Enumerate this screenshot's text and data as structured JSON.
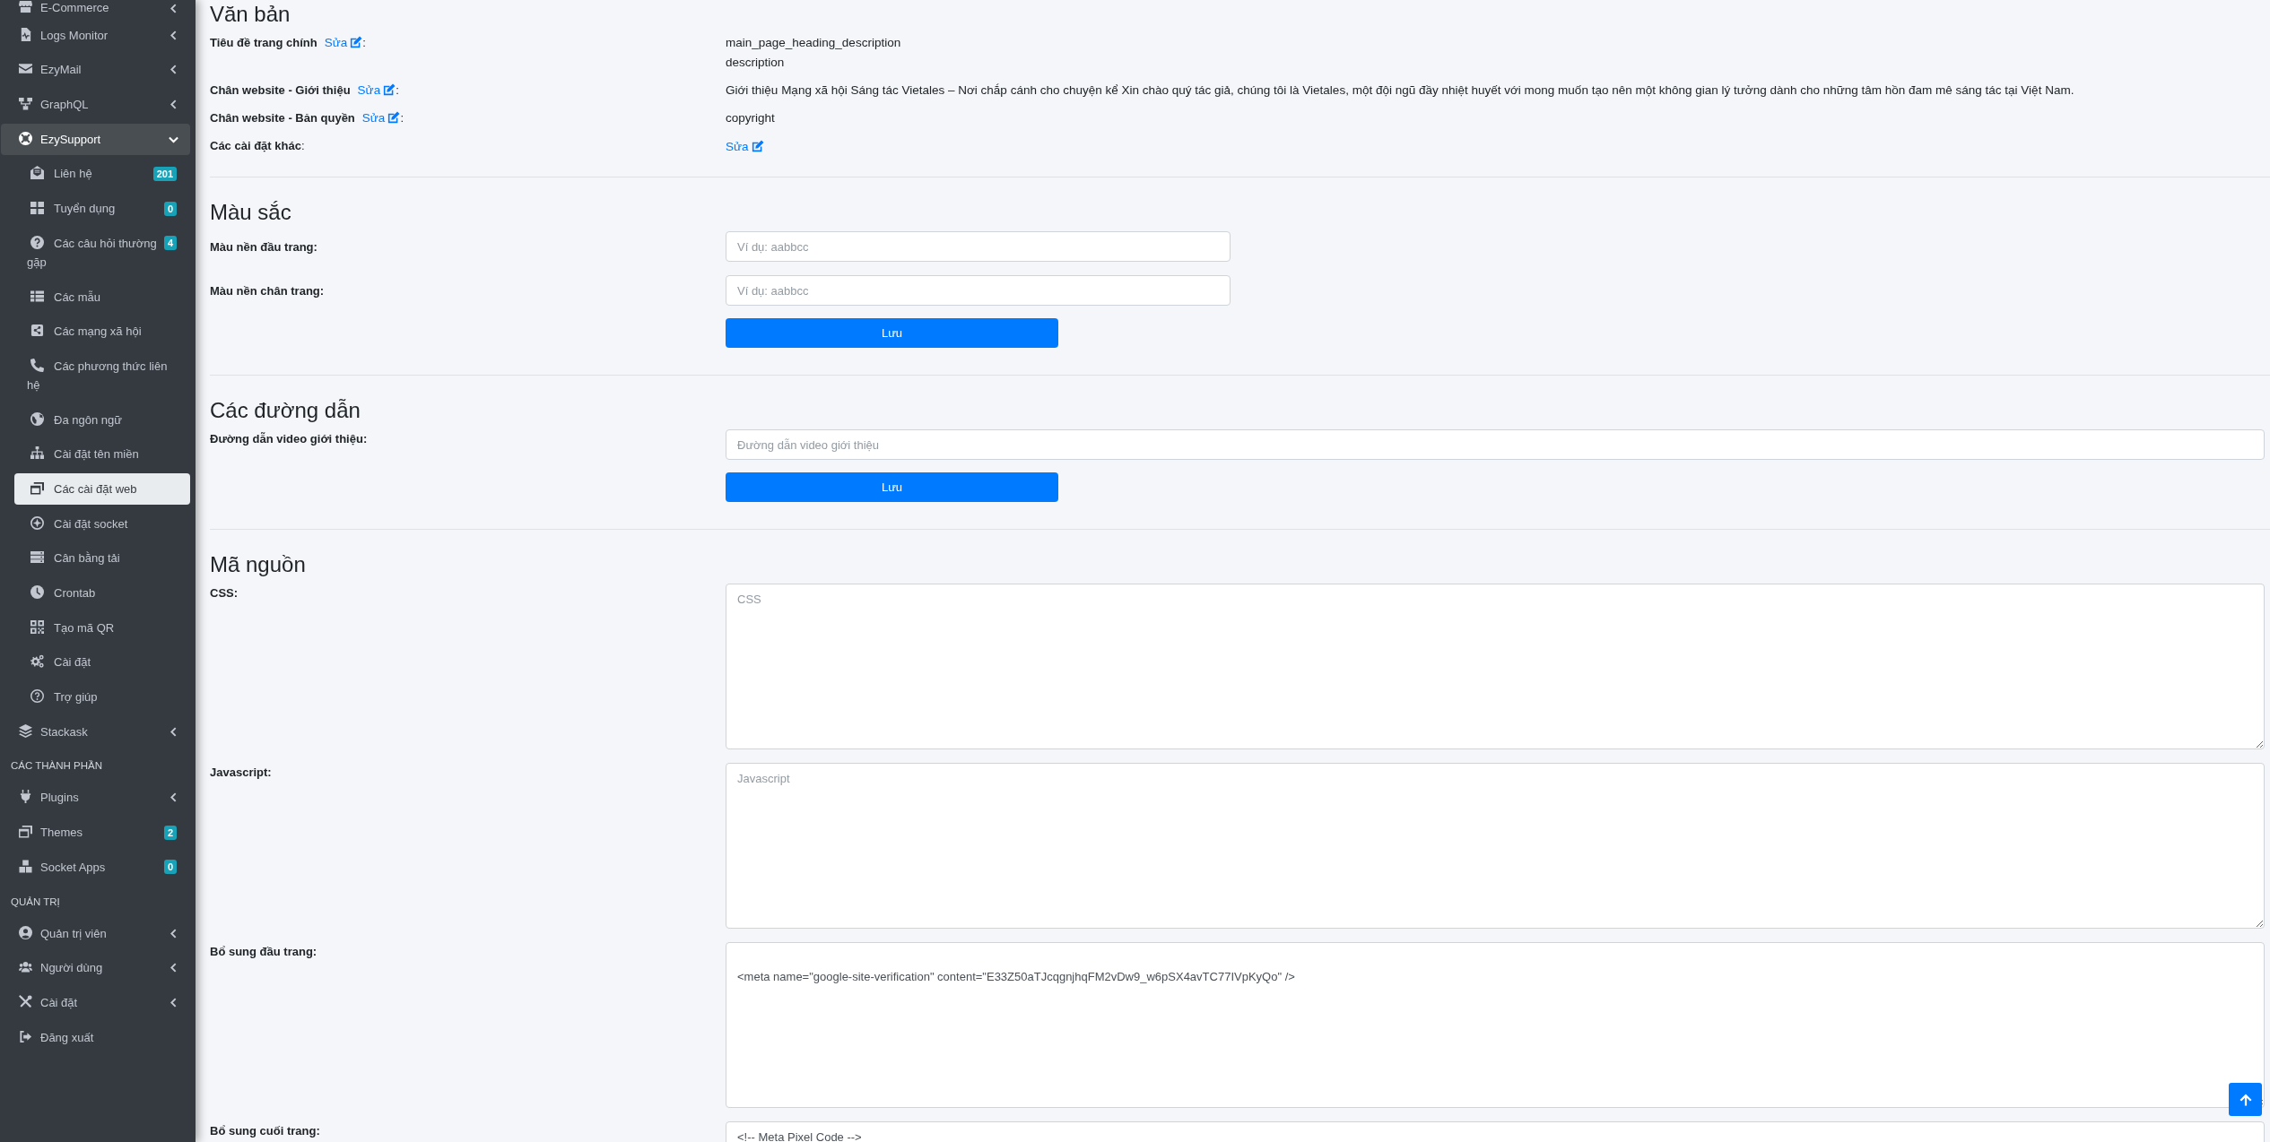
{
  "sidebar": {
    "sections": [
      {
        "items": [
          {
            "label": "E-Commerce",
            "kind": "menu",
            "expanded": false,
            "selected": false
          },
          {
            "label": "Logs Monitor",
            "kind": "menu",
            "expanded": false,
            "selected": false
          },
          {
            "label": "EzyMail",
            "kind": "menu",
            "expanded": false,
            "selected": false
          },
          {
            "label": "GraphQL",
            "kind": "menu",
            "expanded": false,
            "selected": false
          },
          {
            "label": "EzySupport",
            "kind": "menu",
            "expanded": true,
            "selected": true,
            "children": [
              {
                "label": "Liên hệ",
                "badge": "201",
                "selected": false
              },
              {
                "label": "Tuyển dụng",
                "badge": "0",
                "selected": false
              },
              {
                "label": "Các câu hỏi thường gặp",
                "badge": "4",
                "selected": false
              },
              {
                "label": "Các mẫu",
                "selected": false
              },
              {
                "label": "Các mạng xã hội",
                "selected": false
              },
              {
                "label": "Các phương thức liên hệ",
                "selected": false
              },
              {
                "label": "Đa ngôn ngữ",
                "selected": false
              },
              {
                "label": "Cài đặt tên miền",
                "selected": false
              },
              {
                "label": "Các cài đặt web",
                "selected": true
              },
              {
                "label": "Cài đặt socket",
                "selected": false
              },
              {
                "label": "Cân bằng tải",
                "selected": false
              },
              {
                "label": "Crontab",
                "selected": false
              },
              {
                "label": "Tạo mã QR",
                "selected": false
              },
              {
                "label": "Cài đặt",
                "selected": false
              },
              {
                "label": "Trợ giúp",
                "selected": false
              }
            ]
          },
          {
            "label": "Stackask",
            "kind": "menu",
            "expanded": false,
            "selected": false
          }
        ]
      },
      {
        "heading": "CÁC THÀNH PHẦN",
        "items": [
          {
            "label": "Plugins",
            "kind": "menu",
            "expanded": false,
            "selected": false
          },
          {
            "label": "Themes",
            "kind": "link",
            "badge": "2",
            "selected": false
          },
          {
            "label": "Socket Apps",
            "kind": "link",
            "badge": "0",
            "selected": false
          }
        ]
      },
      {
        "heading": "QUẢN TRỊ",
        "items": [
          {
            "label": "Quản trị viên",
            "kind": "menu",
            "expanded": false,
            "selected": false
          },
          {
            "label": "Người dùng",
            "kind": "menu",
            "expanded": false,
            "selected": false
          },
          {
            "label": "Cài đặt",
            "kind": "menu",
            "expanded": false,
            "selected": false
          },
          {
            "label": "Đăng xuất",
            "kind": "link",
            "selected": false
          }
        ]
      }
    ]
  },
  "sections": [
    {
      "kind": "text",
      "title": "Văn bản",
      "rows": [
        {
          "kind": "text",
          "label": "Tiêu đề trang chính",
          "edit": "Sửa",
          "colon": ":",
          "lines": [
            "main_page_heading_description",
            "description"
          ]
        },
        {
          "kind": "text",
          "label": "Chân website - Giới thiệu",
          "edit": "Sửa",
          "colon": ":",
          "lines": [
            "Giới thiệu Mạng xã hội Sáng tác Vietales – Nơi chắp cánh cho chuyện kể Xin chào quý tác giả, chúng tôi là Vietales, một đội ngũ đầy nhiệt huyết với mong muốn tạo nên một không gian lý tưởng dành cho những tâm hồn đam mê sáng tác tại Việt Nam."
          ]
        },
        {
          "kind": "text",
          "label": "Chân website - Bản quyền",
          "edit": "Sửa",
          "colon": ":",
          "lines": [
            "copyright"
          ]
        },
        {
          "kind": "link",
          "label": "Các cài đặt khác",
          "colon": ":",
          "edit": "Sửa"
        }
      ]
    },
    {
      "kind": "form",
      "title": "Màu sắc",
      "fields": [
        {
          "kind": "color_input",
          "label": "Màu nền đầu trang:",
          "placeholder": "Ví dụ: aabbcc"
        },
        {
          "kind": "color_input",
          "label": "Màu nền chân trang:",
          "placeholder": "Ví dụ: aabbcc"
        }
      ],
      "button": "Lưu"
    },
    {
      "kind": "form",
      "title": "Các đường dẫn",
      "fields": [
        {
          "kind": "text_input",
          "label": "Đường dẫn video giới thiệu:",
          "placeholder": "Đường dẫn video giới thiệu"
        }
      ],
      "button": "Lưu"
    },
    {
      "kind": "form",
      "title": "Mã nguồn",
      "fields": [
        {
          "kind": "textarea",
          "label": "CSS:",
          "placeholder": "CSS"
        },
        {
          "kind": "textarea",
          "label": "Javascript:",
          "placeholder": "Javascript"
        },
        {
          "kind": "textarea",
          "label": "Bổ sung đầu trang:",
          "value": "\n<meta name=\"google-site-verification\" content=\"E33Z50aTJcqgnjhqFM2vDw9_w6pSX4avTC77IVpKyQo\" />"
        },
        {
          "kind": "textarea",
          "label": "Bổ sung cuối trang:",
          "value": "<!-- Meta Pixel Code -->"
        }
      ]
    }
  ]
}
